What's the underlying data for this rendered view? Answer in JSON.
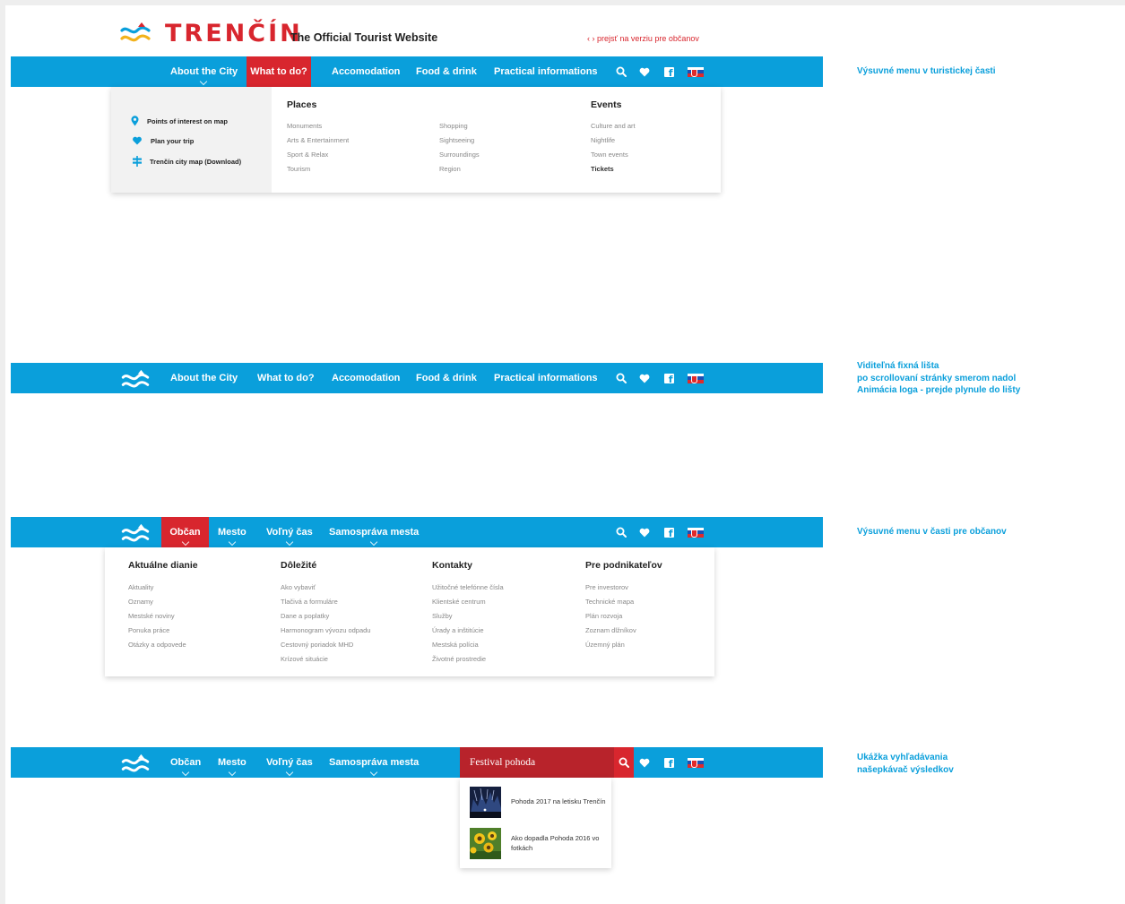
{
  "colors": {
    "accent_blue": "#0a9fdb",
    "brand_red": "#d8262e",
    "search_red": "#b8232b"
  },
  "header": {
    "brand": "TRENČÍN",
    "tagline": "The Official Tourist Website",
    "switch_link": "‹ › prejsť na verziu pre občanov"
  },
  "tourist_nav": {
    "items": [
      {
        "label": "About the City"
      },
      {
        "label": "What to do?",
        "active": true
      },
      {
        "label": "Accomodation"
      },
      {
        "label": "Food & drink"
      },
      {
        "label": "Practical informations"
      }
    ],
    "icons": [
      "search-icon",
      "heart-icon",
      "facebook-icon",
      "slovak-flag-icon"
    ]
  },
  "tourist_menu": {
    "quick_links": [
      {
        "icon": "map-pin-icon",
        "label": "Points of interest on map"
      },
      {
        "icon": "heart-icon",
        "label": "Plan your trip"
      },
      {
        "icon": "signpost-icon",
        "label": "Trenčín city map (Download)"
      }
    ],
    "places_title": "Places",
    "places_left": [
      "Monuments",
      "Arts & Entertainment",
      "Sport & Relax",
      "Tourism"
    ],
    "places_right": [
      "Shopping",
      "Sightseeing",
      "Surroundings",
      "Region"
    ],
    "events_title": "Events",
    "events": [
      "Culture and art",
      "Nightlife",
      "Town events",
      "Tickets"
    ]
  },
  "notes": {
    "tourist_menu": "Výsuvné menu v turistickej časti",
    "sticky": [
      "Viditeľná fixná lišta",
      "po scrollovaní stránky smerom nadol",
      "Animácia loga - prejde plynule do lišty"
    ],
    "citizen_menu": "Výsuvné menu v časti pre občanov",
    "search": [
      "Ukážka vyhľadávania",
      "našepkávač výsledkov"
    ]
  },
  "citizen_nav": {
    "items": [
      {
        "label": "Občan",
        "active": true
      },
      {
        "label": "Mesto"
      },
      {
        "label": "Voľný čas"
      },
      {
        "label": "Samospráva mesta"
      }
    ]
  },
  "citizen_menu": {
    "columns": [
      {
        "title": "Aktuálne dianie",
        "links": [
          "Aktuality",
          "Oznamy",
          "Mestské noviny",
          "Ponuka práce",
          "Otázky a odpovede"
        ]
      },
      {
        "title": "Dôležité",
        "links": [
          "Ako vybaviť",
          "Tlačivá a formuláre",
          "Dane a poplatky",
          "Harmonogram vývozu odpadu",
          "Cestovný poriadok MHD",
          "Krízové situácie"
        ]
      },
      {
        "title": "Kontakty",
        "links": [
          "Užitočné telefónne čísla",
          "Klientské centrum",
          "Služby",
          "Úrady a inštitúcie",
          "Mestská polícia",
          "Životné prostredie"
        ]
      },
      {
        "title": "Pre podnikateľov",
        "links": [
          "Pre investorov",
          "Technické mapa",
          "Plán rozvoja",
          "Zoznam dlžníkov",
          "Územný plán"
        ]
      }
    ]
  },
  "search": {
    "query": "Festival pohoda",
    "results": [
      {
        "title": "Pohoda 2017 na letisku Trenčín"
      },
      {
        "title": "Ako dopadla Pohoda 2016 vo fotkách"
      }
    ]
  }
}
